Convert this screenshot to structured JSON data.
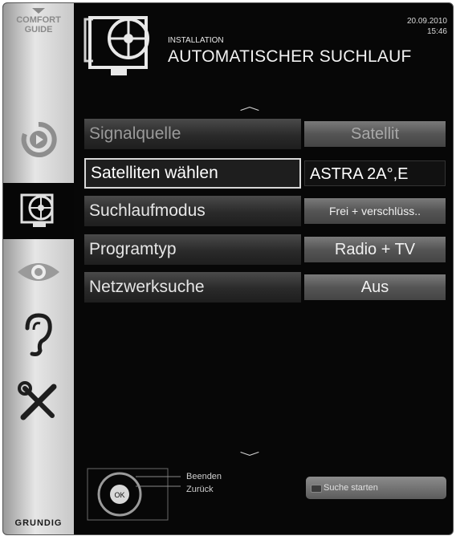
{
  "sidebar": {
    "comfort_label_1": "COMFORT",
    "comfort_label_2": "GUIDE",
    "items": [
      {
        "icon": "source-icon"
      },
      {
        "icon": "satellite-dish-icon",
        "active": true
      },
      {
        "icon": "eye-icon"
      },
      {
        "icon": "ear-icon"
      },
      {
        "icon": "tools-icon"
      }
    ],
    "brand": "GRUNDIG"
  },
  "header": {
    "section": "INSTALLATION",
    "title": "AUTOMATISCHER SUCHLAUF",
    "date": "20.09.2010",
    "time": "15:46",
    "icon": "satellite-dish-icon"
  },
  "menu": {
    "rows": [
      {
        "label": "Signalquelle",
        "value": "Satellit",
        "state": "disabled"
      },
      {
        "label": "Satelliten wählen",
        "value": "ASTRA 2A°,E",
        "state": "selected"
      },
      {
        "label": "Suchlaufmodus",
        "value": "Frei + verschlüss..",
        "state": "normal"
      },
      {
        "label": "Programtyp",
        "value": "Radio + TV",
        "state": "normal"
      },
      {
        "label": "Netzwerksuche",
        "value": "Aus",
        "state": "normal"
      }
    ],
    "up_arrow": "︿",
    "down_arrow": "﹀"
  },
  "footer": {
    "exit_label": "Beenden",
    "back_label": "Zurück",
    "ok_label": "OK",
    "start_label": "Suche starten"
  },
  "colors": {
    "background": "#070707",
    "sidebar": "#d8d8d8",
    "value_box": "#5a5a5a",
    "selected_border": "#d8d8d8"
  }
}
